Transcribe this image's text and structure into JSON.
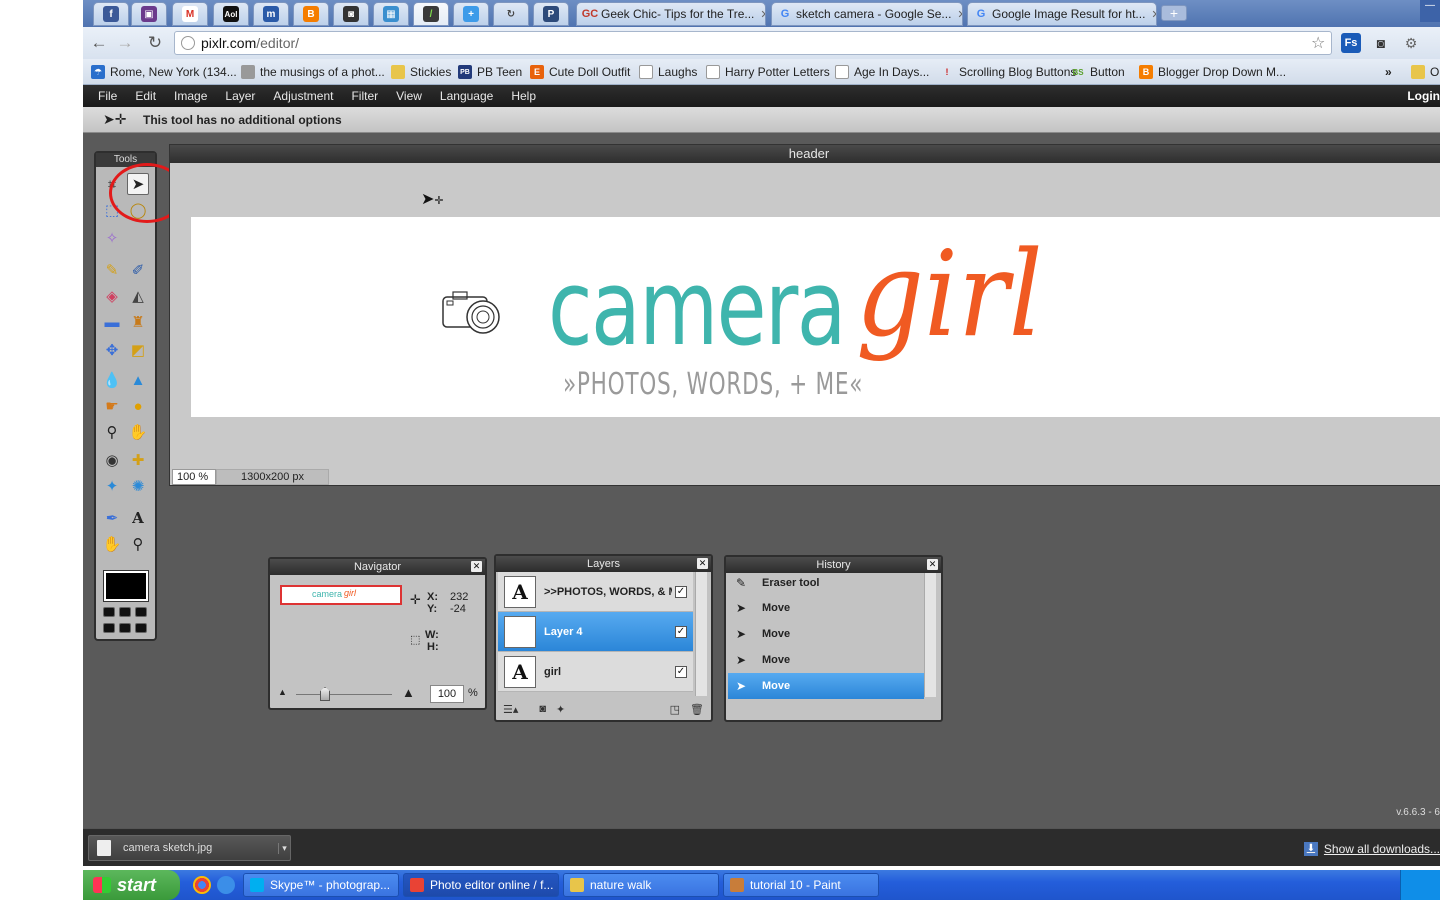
{
  "browser": {
    "pinned_tabs": [
      {
        "icon": "facebook-icon",
        "glyph": "f",
        "color": "#3b5998"
      },
      {
        "icon": "purple-app-icon",
        "glyph": "▣",
        "color": "#6b3a8c"
      },
      {
        "icon": "gmail-icon",
        "glyph": "M",
        "color": "#d93025"
      },
      {
        "icon": "aol-icon",
        "glyph": "Aol",
        "color": "#111111"
      },
      {
        "icon": "m-app-icon",
        "glyph": "m",
        "color": "#2a5aa8"
      },
      {
        "icon": "blogger-icon",
        "glyph": "B",
        "color": "#f57d00"
      },
      {
        "icon": "camera-app-icon",
        "glyph": "◙",
        "color": "#333333"
      },
      {
        "icon": "picture-app-icon",
        "glyph": "▦",
        "color": "#3a8fcf"
      },
      {
        "icon": "pixlr-icon",
        "glyph": "/",
        "color": "#3a3a3a"
      },
      {
        "icon": "plus-app-icon",
        "glyph": "+",
        "color": "#3d9be9"
      },
      {
        "icon": "refresh-app-icon",
        "glyph": "↻",
        "color": "#444444"
      },
      {
        "icon": "p-app-icon",
        "glyph": "P",
        "color": "#2d4a7a"
      }
    ],
    "tabs": [
      {
        "title": "Geek Chic- Tips for the Tre...",
        "fav": "GC",
        "fav_color": "#c0392b"
      },
      {
        "title": "sketch camera - Google Se...",
        "fav": "G",
        "fav_color": "#4285f4"
      },
      {
        "title": "Google Image Result for ht...",
        "fav": "G",
        "fav_color": "#4285f4"
      }
    ],
    "new_tab": "+",
    "url_host": "pixlr.com",
    "url_path": "/editor/",
    "bookmarks": [
      {
        "label": "Rome, New York (134...",
        "icon": "weather-icon",
        "color": "#2a6fcc",
        "glyph": "☂"
      },
      {
        "label": "the musings of a phot...",
        "icon": "blog-icon",
        "color": "#999999",
        "glyph": " "
      },
      {
        "label": "Stickies",
        "icon": "folder-icon",
        "color": "#e8c54a",
        "glyph": " "
      },
      {
        "label": "PB Teen",
        "icon": "pbteen-icon",
        "color": "#223a7a",
        "glyph": "PB"
      },
      {
        "label": "Cute Doll Outfit",
        "icon": "etsy-icon",
        "color": "#e8620c",
        "glyph": "E"
      },
      {
        "label": "Laughs",
        "icon": "page-icon",
        "color": "#cccccc",
        "glyph": " "
      },
      {
        "label": "Harry Potter Letters",
        "icon": "page-icon",
        "color": "#cccccc",
        "glyph": " "
      },
      {
        "label": "Age In Days...",
        "icon": "page-icon",
        "color": "#cccccc",
        "glyph": " "
      },
      {
        "label": "Scrolling Blog Buttons",
        "icon": "pin-icon",
        "color": "#cc2222",
        "glyph": "!"
      },
      {
        "label": "Button",
        "icon": "bs-icon",
        "color": "#5aa02c",
        "glyph": "BS"
      },
      {
        "label": "Blogger Drop Down M...",
        "icon": "blogger-icon",
        "color": "#f57d00",
        "glyph": "B"
      }
    ],
    "bookmarks_more": "»",
    "other_bookmarks": "O"
  },
  "pixlr": {
    "menu": [
      "File",
      "Edit",
      "Image",
      "Layer",
      "Adjustment",
      "Filter",
      "View",
      "Language",
      "Help"
    ],
    "login": "Login",
    "options_text": "This tool has no additional options",
    "tools_title": "Tools",
    "document": {
      "title": "header",
      "zoom": "100 %",
      "dimensions": "1300x200 px",
      "logo_camera": "camera",
      "logo_girl": "girl",
      "logo_tagline": "»PHOTOS, WORDS, + ME«"
    },
    "navigator": {
      "title": "Navigator",
      "thumb_camera": "camera",
      "thumb_girl": "girl",
      "x_label": "X:",
      "x_value": "232",
      "y_label": "Y:",
      "y_value": "-24",
      "w_label": "W:",
      "h_label": "H:",
      "zoom_value": "100",
      "zoom_unit": "%"
    },
    "layers": {
      "title": "Layers",
      "items": [
        {
          "name": ">>PHOTOS, WORDS, & ME<<",
          "thumb": "A",
          "visible": "✓"
        },
        {
          "name": "Layer 4",
          "thumb": "",
          "visible": "✓"
        },
        {
          "name": "girl",
          "thumb": "A",
          "visible": "✓"
        }
      ]
    },
    "history": {
      "title": "History",
      "items": [
        "Eraser tool",
        "Move",
        "Move",
        "Move",
        "Move"
      ]
    },
    "version": "v.6.6.3 - 6"
  },
  "downloads": {
    "file": "camera sketch.jpg",
    "show_all": "Show all downloads..."
  },
  "taskbar": {
    "start": "start",
    "tasks": [
      {
        "label": "Skype™ - photograp...",
        "color": "#00aff0"
      },
      {
        "label": "Photo editor online / f...",
        "color": "#e94335"
      },
      {
        "label": "nature walk",
        "color": "#e8c54a"
      },
      {
        "label": "tutorial 10 - Paint",
        "color": "#c87d3a"
      }
    ]
  }
}
